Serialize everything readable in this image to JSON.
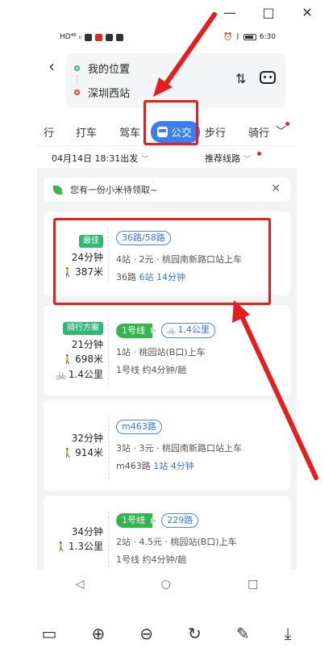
{
  "window": {
    "minimize": "—",
    "maximize": "□",
    "close": "✕"
  },
  "statusbar": {
    "left": "HD⁴⁶ ᵢₗ",
    "time": "6:30"
  },
  "route": {
    "back_icon": "‹",
    "origin": "我的位置",
    "destination": "深圳西站",
    "swap_icon": "⇅"
  },
  "tabs": [
    {
      "label": "行"
    },
    {
      "label": "打车"
    },
    {
      "label": "驾车"
    },
    {
      "label": "公交",
      "active": true
    },
    {
      "label": "步行"
    },
    {
      "label": "骑行"
    }
  ],
  "filter": {
    "time": "04月14日 18:31出发",
    "sort": "推荐线路"
  },
  "notice": {
    "text": "您有一份小米待领取~",
    "close": "✕"
  },
  "routes": [
    {
      "badge": "最佳",
      "duration": "24分钟",
      "walk": "387米",
      "tags": [
        "36路/58路"
      ],
      "detail": "4站 · 2元 · 桃园南新路口站上车",
      "sub_prefix": "36路 ",
      "sub_blue": "6站 14分钟"
    },
    {
      "badge": "骑行方案",
      "duration": "21分钟",
      "walk": "698米",
      "bike": "1.4公里",
      "tag_green": "1号线",
      "tag_bike": "1.4公里",
      "detail": "1站 · 桃园站(B口)上车",
      "sub": "1号线 约4分钟/趟"
    },
    {
      "duration": "32分钟",
      "walk": "914米",
      "tags": [
        "m463路"
      ],
      "detail": "3站 · 3元 · 桃园南新路口站上车",
      "sub_prefix": "m463路 ",
      "sub_blue": "1站 4分钟"
    },
    {
      "duration": "34分钟",
      "walk": "1.3公里",
      "tag_green": "1号线",
      "tags": [
        "229路"
      ],
      "detail": "2站 · 4.5元 · 桃园站(B口)上车",
      "sub": "1号线 约4分钟/趟"
    }
  ],
  "navbar": {
    "back": "◁",
    "home": "○",
    "recent": "□"
  },
  "toolbar": {
    "zoom_in": "⊕",
    "zoom_out": "⊖",
    "rotate": "↻",
    "edit": "✎",
    "download": "⤓"
  },
  "colors": {
    "accent": "#3a7ef0",
    "annotation": "#e61e1e",
    "green": "#2fb875"
  }
}
